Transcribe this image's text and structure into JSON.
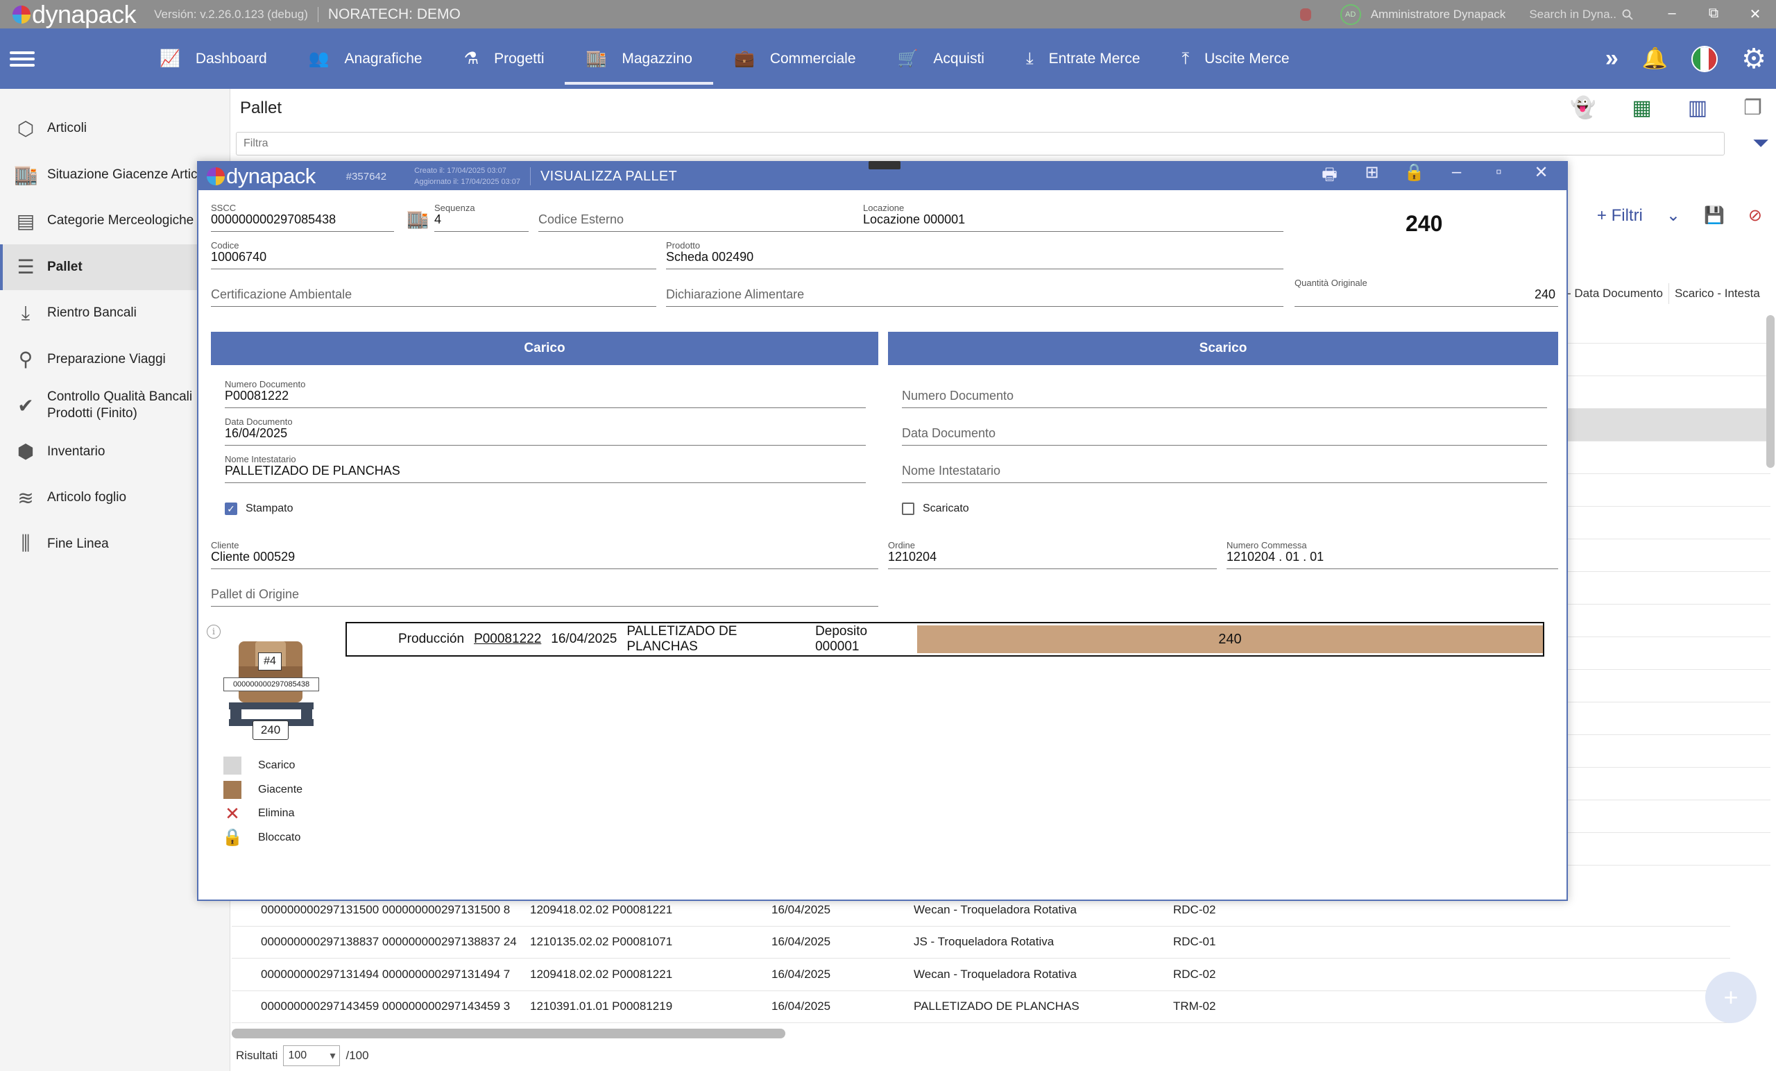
{
  "titlebar": {
    "app_name": "dynapack",
    "version": "Versión: v.2.26.0.123 (debug)",
    "company": "NORATECH: DEMO",
    "avatar_initials": "AD",
    "user": "Amministratore Dynapack",
    "search_placeholder": "Search in Dyna..",
    "minimize": "–",
    "restore": "⧉",
    "close": "✕"
  },
  "nav": {
    "items": [
      {
        "label": "Dashboard",
        "icon": "chart-icon"
      },
      {
        "label": "Anagrafiche",
        "icon": "people-icon"
      },
      {
        "label": "Progetti",
        "icon": "flask-icon"
      },
      {
        "label": "Magazzino",
        "icon": "warehouse-icon",
        "active": true
      },
      {
        "label": "Commerciale",
        "icon": "briefcase-icon"
      },
      {
        "label": "Acquisti",
        "icon": "cart-icon"
      },
      {
        "label": "Entrate Merce",
        "icon": "download-icon"
      },
      {
        "label": "Uscite Merce",
        "icon": "upload-icon"
      }
    ]
  },
  "sidebar": {
    "items": [
      {
        "label": "Articoli"
      },
      {
        "label": "Situazione Giacenze Artico"
      },
      {
        "label": "Categorie Merceologiche"
      },
      {
        "label": "Pallet",
        "active": true
      },
      {
        "label": "Rientro Bancali"
      },
      {
        "label": "Preparazione Viaggi"
      },
      {
        "label": "Controllo Qualità Bancali Prodotti (Finito)"
      },
      {
        "label": "Inventario"
      },
      {
        "label": "Articolo foglio"
      },
      {
        "label": "Fine Linea"
      }
    ]
  },
  "content": {
    "title": "Pallet",
    "filter_placeholder": "Filtra",
    "filtri_label": "+ Filtri",
    "columns_visible": [
      "- Data Documento",
      "Scarico - Intesta"
    ],
    "rows": [
      {
        "sscc": "000000000297131500 000000000297131500 8",
        "ref": "1209418.02.02 P00081221",
        "date": "16/04/2025",
        "intestatario": "Wecan - Troqueladora Rotativa",
        "loc": "RDC-02"
      },
      {
        "sscc": "000000000297138837 000000000297138837 24",
        "ref": "1210135.02.02 P00081071",
        "date": "16/04/2025",
        "intestatario": "JS - Troqueladora Rotativa",
        "loc": "RDC-01"
      },
      {
        "sscc": "000000000297131494 000000000297131494 7",
        "ref": "1209418.02.02 P00081221",
        "date": "16/04/2025",
        "intestatario": "Wecan - Troqueladora Rotativa",
        "loc": "RDC-02"
      },
      {
        "sscc": "000000000297143459 000000000297143459 3",
        "ref": "1210391.01.01 P00081219",
        "date": "16/04/2025",
        "intestatario": "PALLETIZADO DE PLANCHAS",
        "loc": "TRM-02"
      }
    ],
    "risultati_label": "Risultati",
    "risultati_value": "100",
    "risultati_total": "/100"
  },
  "modal": {
    "app_name": "dynapack",
    "record_id": "#357642",
    "created": "Creato il: 17/04/2025 03:07",
    "updated": "Aggiornato il: 17/04/2025 03:07",
    "title": "VISUALIZZA PALLET",
    "fields": {
      "sscc_label": "SSCC",
      "sscc": "000000000297085438",
      "sequenza_label": "Sequenza",
      "sequenza": "4",
      "codice_esterno_ph": "Codice Esterno",
      "locazione_label": "Locazione",
      "locazione": "Locazione 000001",
      "quantity": "240",
      "codice_label": "Codice",
      "codice": "10006740",
      "prodotto_label": "Prodotto",
      "prodotto": "Scheda 002490",
      "cert_ambientale_ph": "Certificazione Ambientale",
      "dich_alimentare_ph": "Dichiarazione Alimentare",
      "qta_originale_label": "Quantità Originale",
      "qta_originale": "240"
    },
    "carico": {
      "title": "Carico",
      "num_doc_label": "Numero Documento",
      "num_doc": "P00081222",
      "data_doc_label": "Data Documento",
      "data_doc": "16/04/2025",
      "intestatario_label": "Nome Intestatario",
      "intestatario": "PALLETIZADO DE PLANCHAS",
      "stampato_label": "Stampato",
      "stampato": true
    },
    "scarico": {
      "title": "Scarico",
      "num_doc_ph": "Numero Documento",
      "data_doc_ph": "Data Documento",
      "intestatario_ph": "Nome Intestatario",
      "scaricato_label": "Scaricato",
      "scaricato": false
    },
    "cliente_label": "Cliente",
    "cliente": "Cliente 000529",
    "ordine_label": "Ordine",
    "ordine": "1210204",
    "commessa_label": "Numero Commessa",
    "commessa": "1210204 . 01 . 01",
    "pallet_origine_ph": "Pallet di Origine",
    "graphic": {
      "seq": "#4",
      "sscc": "000000000297085438",
      "qty": "240"
    },
    "legend": [
      {
        "label": "Scarico",
        "color": "#d6d6d6"
      },
      {
        "label": "Giacente",
        "color": "#a47a52"
      },
      {
        "label": "Elimina",
        "color": "#c43a3a"
      },
      {
        "label": "Bloccato",
        "color": "#888888"
      }
    ],
    "movement": {
      "type": "Producción",
      "doc": "P00081222",
      "date": "16/04/2025",
      "intestatario": "PALLETIZADO DE PLANCHAS",
      "deposito": "Deposito 000001",
      "qty": "240"
    }
  },
  "colors": {
    "primary": "#5571b5",
    "box": "#a47a52",
    "movement_bar": "#c9a27e"
  }
}
